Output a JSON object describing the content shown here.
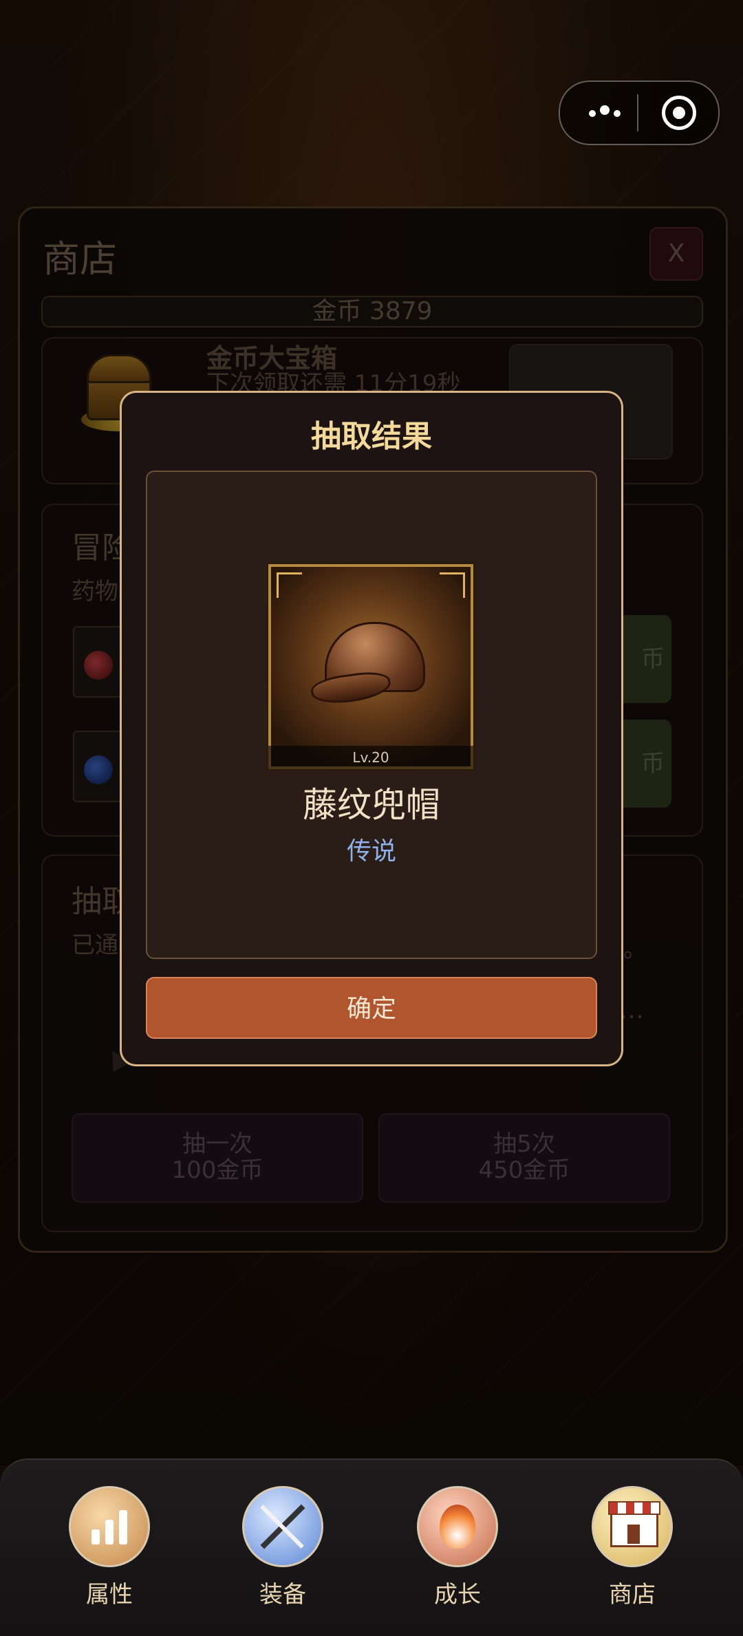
{
  "shop": {
    "title": "商店",
    "close_label": "X",
    "gold_label": "金币 3879",
    "chest": {
      "name": "金币大宝箱",
      "subtitle": "下次领取还需 11分19秒"
    },
    "adventure": {
      "title": "冒险",
      "subtitle": "药物"
    },
    "potions": [
      {
        "buy_label": "币"
      },
      {
        "buy_label": "币"
      }
    ],
    "gacha": {
      "title": "抽取",
      "subtitle": "已通",
      "subtitle_end": "。",
      "ellipsis": "…",
      "draw_one": {
        "line1": "抽一次",
        "line2": "100金币"
      },
      "draw_five": {
        "line1": "抽5次",
        "line2": "450金币"
      }
    }
  },
  "modal": {
    "title": "抽取结果",
    "item_level": "Lv.20",
    "item_name": "藤纹兜帽",
    "item_rarity": "传说",
    "confirm_label": "确定"
  },
  "nav": {
    "items": [
      {
        "label": "属性",
        "icon": "stats-icon"
      },
      {
        "label": "装备",
        "icon": "equipment-icon"
      },
      {
        "label": "成长",
        "icon": "flame-icon"
      },
      {
        "label": "商店",
        "icon": "store-icon"
      }
    ]
  },
  "colors": {
    "accent_gold": "#f3d99a",
    "confirm_button": "#b0552e",
    "rarity_legend": "#8fb0e8"
  }
}
